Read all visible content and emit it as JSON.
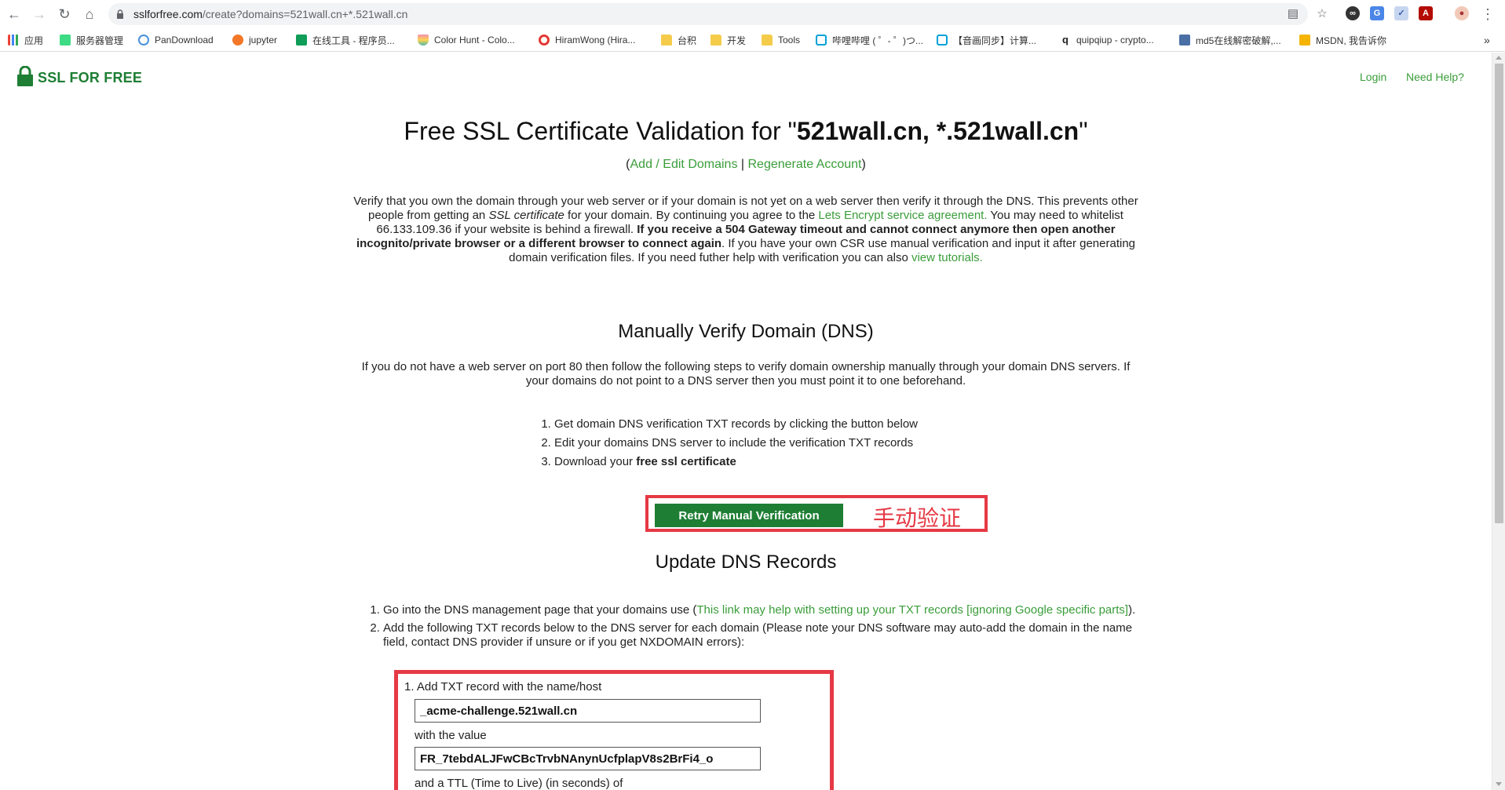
{
  "browser": {
    "url_host": "sslforfree.com",
    "url_path": "/create?domains=521wall.cn+*.521wall.cn",
    "bookmarks": [
      {
        "label": "应用"
      },
      {
        "label": "服务器管理"
      },
      {
        "label": "PanDownload"
      },
      {
        "label": "jupyter"
      },
      {
        "label": "在线工具 - 程序员..."
      },
      {
        "label": "Color Hunt - Colo..."
      },
      {
        "label": "HiramWong (Hira..."
      },
      {
        "label": "台积"
      },
      {
        "label": "开发"
      },
      {
        "label": "Tools"
      },
      {
        "label": "哔哩哔哩 ( ゜- ゜)つ..."
      },
      {
        "label": "【音画同步】计算..."
      },
      {
        "label": "quipqiup - crypto..."
      },
      {
        "label": "md5在线解密破解,..."
      },
      {
        "label": "MSDN, 我告诉你"
      }
    ]
  },
  "header": {
    "logo_text": "SSL FOR FREE",
    "login": "Login",
    "help": "Need Help?"
  },
  "hero": {
    "title_prefix": "Free SSL Certificate Validation for \"",
    "title_domains": "521wall.cn, *.521wall.cn",
    "title_suffix": "\"",
    "paren_open": "(",
    "add_edit": "Add / Edit Domains",
    "sep": " | ",
    "regenerate": "Regenerate Account",
    "paren_close": ")"
  },
  "intro": {
    "t1": "Verify that you own the domain through your web server or if your domain is not yet on a web server then verify it through the DNS. This prevents other people from getting an ",
    "t2_italic": "SSL certificate",
    "t3": " for your domain. By continuing you agree to the ",
    "link_agreement": "Lets Encrypt service agreement.",
    "t4": " You may need to whitelist 66.133.109.36 if your website is behind a firewall. ",
    "bold": "If you receive a 504 Gateway timeout and cannot connect anymore then open another incognito/private browser or a different browser to connect again",
    "t5": ". If you have your own CSR use manual verification and input it after generating domain verification files. If you need futher help with verification you can also ",
    "link_tutorials": "view tutorials."
  },
  "manual": {
    "heading": "Manually Verify Domain (DNS)",
    "desc": "If you do not have a web server on port 80 then follow the following steps to verify domain ownership manually through your domain DNS servers. If your domains do not point to a DNS server then you must point it to one beforehand.",
    "step1": "Get domain DNS verification TXT records by clicking the button below",
    "step2": "Edit your domains DNS server to include the verification TXT records",
    "step3_prefix": "Download your ",
    "step3_bold": "free ssl certificate",
    "retry_button": "Retry Manual Verification",
    "annotation": "手动验证"
  },
  "update": {
    "heading": "Update DNS Records",
    "item1_prefix": "Go into the DNS management page that your domains use (",
    "item1_link": "This link may help with setting up your TXT records [ignoring Google specific parts]",
    "item1_suffix": ").",
    "item2": "Add the following TXT records below to the DNS server for each domain (Please note your DNS software may auto-add the domain in the name field, contact DNS provider if unsure or if you get NXDOMAIN errors):",
    "txt_line1": "1. Add TXT record with the name/host",
    "txt_name": "_acme-challenge.521wall.cn",
    "txt_with_value": "with the value",
    "txt_value": "FR_7tebdALJFwCBcTrvbNAnynUcfplapV8s2BrFi4_o",
    "txt_ttl": "and a TTL (Time to Live) (in seconds) of"
  },
  "colors": {
    "brand_green": "#1e7e34",
    "link_green": "#3a9d3a",
    "annotation_red": "#e53945"
  }
}
